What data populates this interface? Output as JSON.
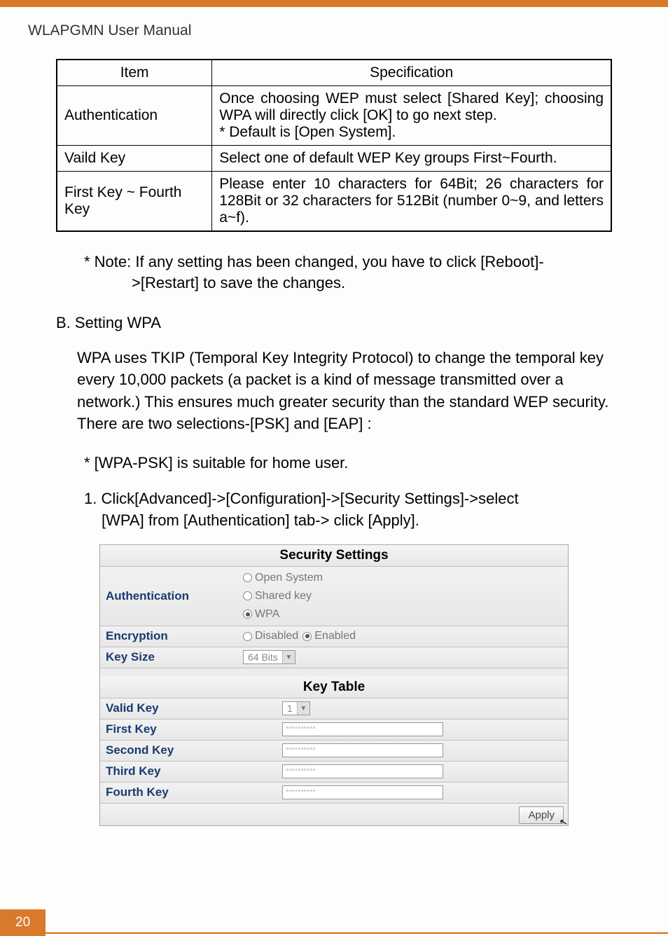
{
  "header": {
    "title": "WLAPGMN User Manual"
  },
  "spec_table": {
    "headers": {
      "item": "Item",
      "spec": "Specification"
    },
    "rows": [
      {
        "item": "Authentication",
        "spec": "Once choosing WEP must select [Shared Key]; choosing WPA will directly click [OK] to go next step.\n* Default is [Open System]."
      },
      {
        "item": "Vaild Key",
        "spec": "Select one of default WEP Key groups First~Fourth."
      },
      {
        "item": "First Key ~ Fourth Key",
        "spec": "Please enter 10 characters for 64Bit; 26 characters for 128Bit or 32 characters for 512Bit (number 0~9, and letters a~f)."
      }
    ]
  },
  "note": {
    "line1": "* Note: If any setting has been changed, you have to click [Reboot]-",
    "line2": ">[Restart] to save the changes."
  },
  "section_b": {
    "title": "B. Setting WPA",
    "body": "WPA uses TKIP (Temporal Key Integrity Protocol) to change the temporal key every 10,000 packets (a packet is a kind of message transmitted over a network.) This ensures much greater security than the standard WEP security. There are two selections-[PSK] and [EAP] :"
  },
  "bullet_psk": "* [WPA-PSK] is suitable for home user.",
  "step1": {
    "line1": "1.  Click[Advanced]->[Configuration]->[Security Settings]->select",
    "line2": "[WPA] from [Authentication] tab-> click [Apply]."
  },
  "screenshot": {
    "security_title": "Security Settings",
    "auth_label": "Authentication",
    "auth_options": {
      "open": "Open System",
      "shared": "Shared key",
      "wpa": "WPA"
    },
    "auth_selected": "wpa",
    "encryption_label": "Encryption",
    "encryption_options": {
      "disabled": "Disabled",
      "enabled": "Enabled"
    },
    "encryption_selected": "enabled",
    "keysize_label": "Key Size",
    "keysize_value": "64 Bits",
    "keytable_title": "Key Table",
    "validkey_label": "Valid Key",
    "validkey_value": "1",
    "keys": [
      {
        "label": "First Key",
        "value": "**********"
      },
      {
        "label": "Second Key",
        "value": "**********"
      },
      {
        "label": "Third Key",
        "value": "**********"
      },
      {
        "label": "Fourth Key",
        "value": "**********"
      }
    ],
    "apply_label": "Apply"
  },
  "footer": {
    "page_number": "20"
  }
}
